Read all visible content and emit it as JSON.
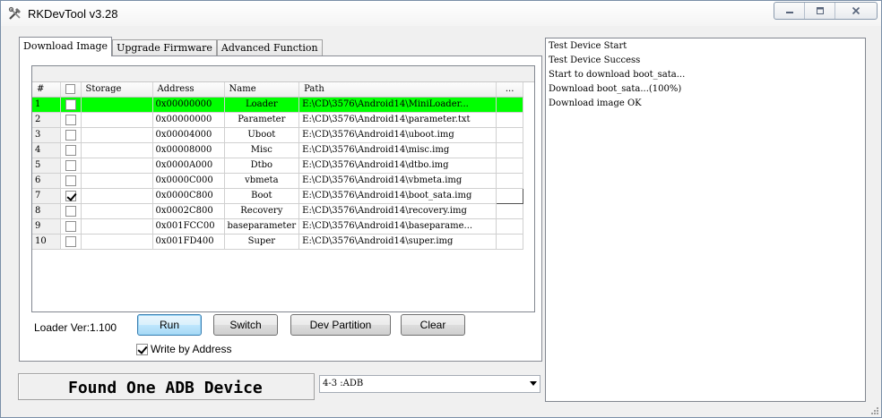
{
  "window": {
    "title": "RKDevTool v3.28"
  },
  "tabs": [
    {
      "label": "Download Image",
      "active": true
    },
    {
      "label": "Upgrade Firmware",
      "active": false
    },
    {
      "label": "Advanced Function",
      "active": false
    }
  ],
  "table": {
    "headers": [
      "#",
      "",
      "Storage",
      "Address",
      "Name",
      "Path",
      "..."
    ],
    "rows": [
      {
        "num": "1",
        "checked": false,
        "storage": "",
        "address": "0x00000000",
        "name": "Loader",
        "path": "E:\\CD\\3576\\Android14\\MiniLoader...",
        "selected": true
      },
      {
        "num": "2",
        "checked": false,
        "storage": "",
        "address": "0x00000000",
        "name": "Parameter",
        "path": "E:\\CD\\3576\\Android14\\parameter.txt"
      },
      {
        "num": "3",
        "checked": false,
        "storage": "",
        "address": "0x00004000",
        "name": "Uboot",
        "path": "E:\\CD\\3576\\Android14\\uboot.img"
      },
      {
        "num": "4",
        "checked": false,
        "storage": "",
        "address": "0x00008000",
        "name": "Misc",
        "path": "E:\\CD\\3576\\Android14\\misc.img"
      },
      {
        "num": "5",
        "checked": false,
        "storage": "",
        "address": "0x0000A000",
        "name": "Dtbo",
        "path": "E:\\CD\\3576\\Android14\\dtbo.img"
      },
      {
        "num": "6",
        "checked": false,
        "storage": "",
        "address": "0x0000C000",
        "name": "vbmeta",
        "path": "E:\\CD\\3576\\Android14\\vbmeta.img"
      },
      {
        "num": "7",
        "checked": true,
        "storage": "",
        "address": "0x0000C800",
        "name": "Boot",
        "path": "E:\\CD\\3576\\Android14\\boot_sata.img"
      },
      {
        "num": "8",
        "checked": false,
        "storage": "",
        "address": "0x0002C800",
        "name": "Recovery",
        "path": "E:\\CD\\3576\\Android14\\recovery.img"
      },
      {
        "num": "9",
        "checked": false,
        "storage": "",
        "address": "0x001FCC00",
        "name": "baseparameter",
        "path": "E:\\CD\\3576\\Android14\\baseparame..."
      },
      {
        "num": "10",
        "checked": false,
        "storage": "",
        "address": "0x001FD400",
        "name": "Super",
        "path": "E:\\CD\\3576\\Android14\\super.img"
      }
    ]
  },
  "controls": {
    "loader_ver": "Loader Ver:1.100",
    "run": "Run",
    "switch": "Switch",
    "dev_partition": "Dev Partition",
    "clear": "Clear",
    "write_by_address": "Write by Address",
    "write_by_address_checked": true
  },
  "status": {
    "text": "Found One ADB Device",
    "device_select": "4-3 :ADB"
  },
  "log": [
    "Test Device Start",
    "Test Device Success",
    "Start to download boot_sata...",
    "Download boot_sata...(100%)",
    "Download image OK"
  ],
  "colors": {
    "selected_row": "#00ff00"
  }
}
